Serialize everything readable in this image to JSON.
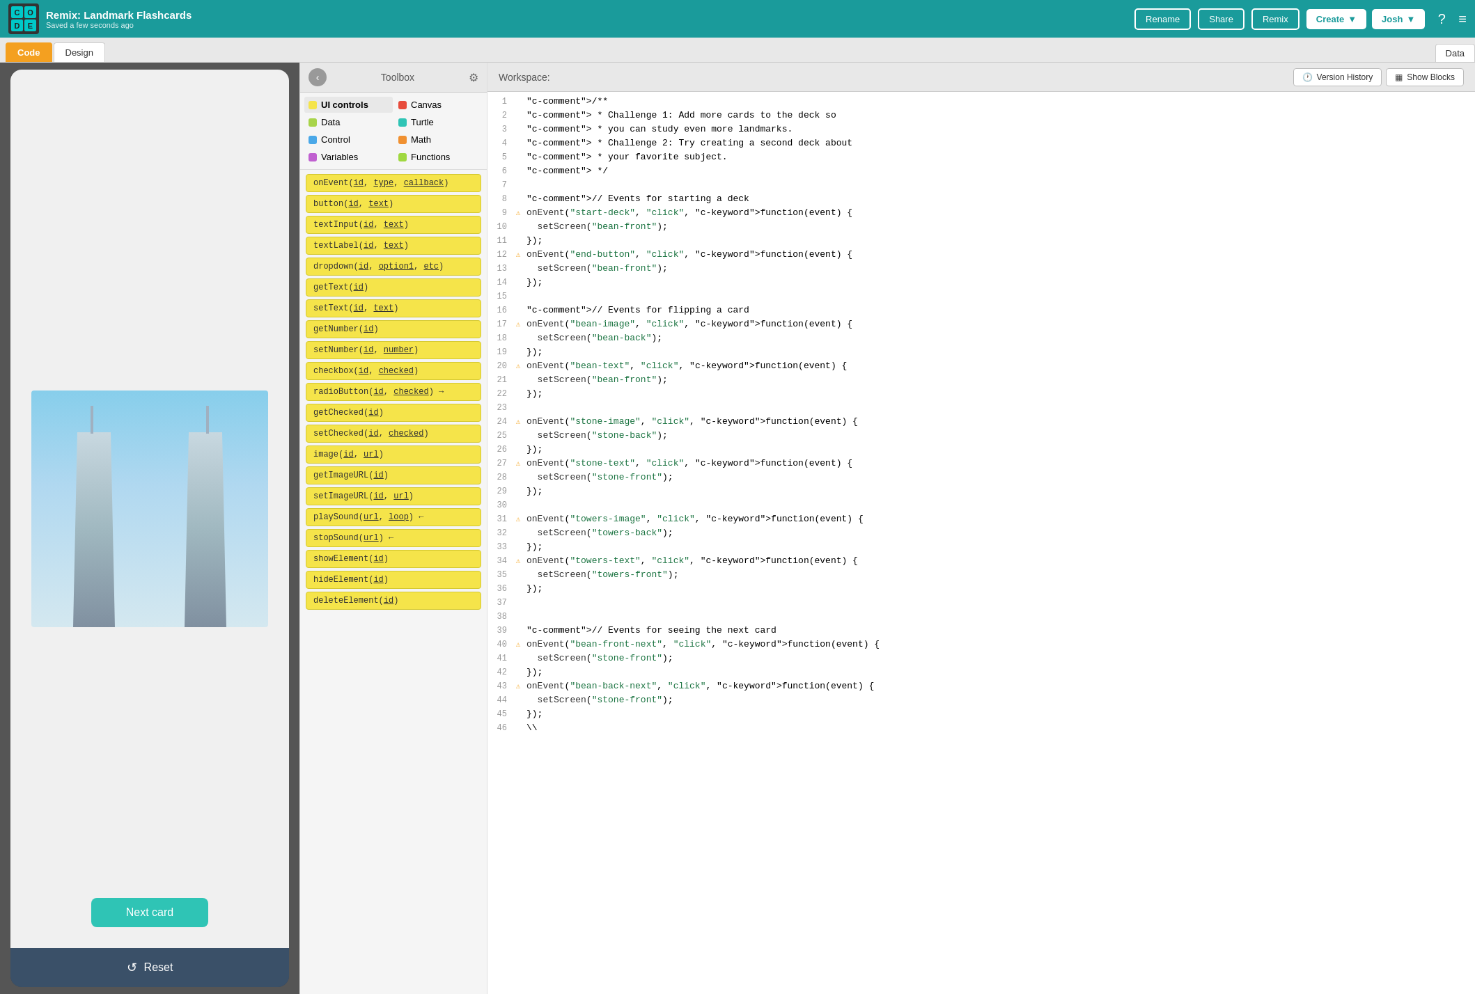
{
  "topbar": {
    "logo_letters": [
      "C",
      "O",
      "D",
      "E"
    ],
    "project_title": "Remix: Landmark Flashcards",
    "project_subtitle": "Saved a few seconds ago",
    "rename_label": "Rename",
    "share_label": "Share",
    "remix_label": "Remix",
    "create_label": "Create",
    "user_label": "Josh",
    "help_label": "?",
    "menu_label": "≡"
  },
  "subtabs": {
    "code_label": "Code",
    "design_label": "Design",
    "data_label": "Data"
  },
  "toolbox": {
    "title": "Toolbox",
    "back_label": "‹",
    "gear_label": "⚙",
    "categories": [
      {
        "name": "UI controls",
        "color": "#f5e44a"
      },
      {
        "name": "Canvas",
        "color": "#e74c3c"
      },
      {
        "name": "Data",
        "color": "#a8d44a"
      },
      {
        "name": "Turtle",
        "color": "#2fc4b5"
      },
      {
        "name": "Control",
        "color": "#4aa8e8"
      },
      {
        "name": "Math",
        "color": "#f09030"
      },
      {
        "name": "Variables",
        "color": "#c060d0"
      },
      {
        "name": "Functions",
        "color": "#a0d840"
      }
    ],
    "blocks": [
      "onEvent(id, type, callback)",
      "button(id, text)",
      "textInput(id, text)",
      "textLabel(id, text)",
      "dropdown(id, option1, etc)",
      "getText(id)",
      "setText(id, text)",
      "getNumber(id)",
      "setNumber(id, number)",
      "checkbox(id, checked)",
      "radioButton(id, checked) →",
      "getChecked(id)",
      "setChecked(id, checked)",
      "image(id, url)",
      "getImageURL(id)",
      "setImageURL(id, url)",
      "playSound(url, loop) ←",
      "stopSound(url) ←",
      "showElement(id)",
      "hideElement(id)",
      "deleteElement(id)"
    ]
  },
  "workspace": {
    "label": "Workspace:",
    "version_history_label": "Version History",
    "show_blocks_label": "Show Blocks",
    "code_lines": [
      {
        "num": 1,
        "warn": false,
        "text": "/**"
      },
      {
        "num": 2,
        "warn": false,
        "text": " * Challenge 1: Add more cards to the deck so"
      },
      {
        "num": 3,
        "warn": false,
        "text": " * you can study even more landmarks."
      },
      {
        "num": 4,
        "warn": false,
        "text": " * Challenge 2: Try creating a second deck about"
      },
      {
        "num": 5,
        "warn": false,
        "text": " * your favorite subject."
      },
      {
        "num": 6,
        "warn": false,
        "text": " */"
      },
      {
        "num": 7,
        "warn": false,
        "text": ""
      },
      {
        "num": 8,
        "warn": false,
        "text": "// Events for starting a deck"
      },
      {
        "num": 9,
        "warn": true,
        "text": "onEvent(\"start-deck\", \"click\", function(event) {"
      },
      {
        "num": 10,
        "warn": false,
        "text": "  setScreen(\"bean-front\");"
      },
      {
        "num": 11,
        "warn": false,
        "text": "});"
      },
      {
        "num": 12,
        "warn": true,
        "text": "onEvent(\"end-button\", \"click\", function(event) {"
      },
      {
        "num": 13,
        "warn": false,
        "text": "  setScreen(\"bean-front\");"
      },
      {
        "num": 14,
        "warn": false,
        "text": "});"
      },
      {
        "num": 15,
        "warn": false,
        "text": ""
      },
      {
        "num": 16,
        "warn": false,
        "text": "// Events for flipping a card"
      },
      {
        "num": 17,
        "warn": true,
        "text": "onEvent(\"bean-image\", \"click\", function(event) {"
      },
      {
        "num": 18,
        "warn": false,
        "text": "  setScreen(\"bean-back\");"
      },
      {
        "num": 19,
        "warn": false,
        "text": "});"
      },
      {
        "num": 20,
        "warn": true,
        "text": "onEvent(\"bean-text\", \"click\", function(event) {"
      },
      {
        "num": 21,
        "warn": false,
        "text": "  setScreen(\"bean-front\");"
      },
      {
        "num": 22,
        "warn": false,
        "text": "});"
      },
      {
        "num": 23,
        "warn": false,
        "text": ""
      },
      {
        "num": 24,
        "warn": true,
        "text": "onEvent(\"stone-image\", \"click\", function(event) {"
      },
      {
        "num": 25,
        "warn": false,
        "text": "  setScreen(\"stone-back\");"
      },
      {
        "num": 26,
        "warn": false,
        "text": "});"
      },
      {
        "num": 27,
        "warn": true,
        "text": "onEvent(\"stone-text\", \"click\", function(event) {"
      },
      {
        "num": 28,
        "warn": false,
        "text": "  setScreen(\"stone-front\");"
      },
      {
        "num": 29,
        "warn": false,
        "text": "});"
      },
      {
        "num": 30,
        "warn": false,
        "text": ""
      },
      {
        "num": 31,
        "warn": true,
        "text": "onEvent(\"towers-image\", \"click\", function(event) {"
      },
      {
        "num": 32,
        "warn": false,
        "text": "  setScreen(\"towers-back\");"
      },
      {
        "num": 33,
        "warn": false,
        "text": "});"
      },
      {
        "num": 34,
        "warn": true,
        "text": "onEvent(\"towers-text\", \"click\", function(event) {"
      },
      {
        "num": 35,
        "warn": false,
        "text": "  setScreen(\"towers-front\");"
      },
      {
        "num": 36,
        "warn": false,
        "text": "});"
      },
      {
        "num": 37,
        "warn": false,
        "text": ""
      },
      {
        "num": 38,
        "warn": false,
        "text": ""
      },
      {
        "num": 39,
        "warn": false,
        "text": "// Events for seeing the next card"
      },
      {
        "num": 40,
        "warn": true,
        "text": "onEvent(\"bean-front-next\", \"click\", function(event) {"
      },
      {
        "num": 41,
        "warn": false,
        "text": "  setScreen(\"stone-front\");"
      },
      {
        "num": 42,
        "warn": false,
        "text": "});"
      },
      {
        "num": 43,
        "warn": true,
        "text": "onEvent(\"bean-back-next\", \"click\", function(event) {"
      },
      {
        "num": 44,
        "warn": false,
        "text": "  setScreen(\"stone-front\");"
      },
      {
        "num": 45,
        "warn": false,
        "text": "});"
      },
      {
        "num": 46,
        "warn": false,
        "text": "\\\\"
      }
    ]
  },
  "preview": {
    "next_card_label": "Next card",
    "reset_label": "Reset"
  }
}
